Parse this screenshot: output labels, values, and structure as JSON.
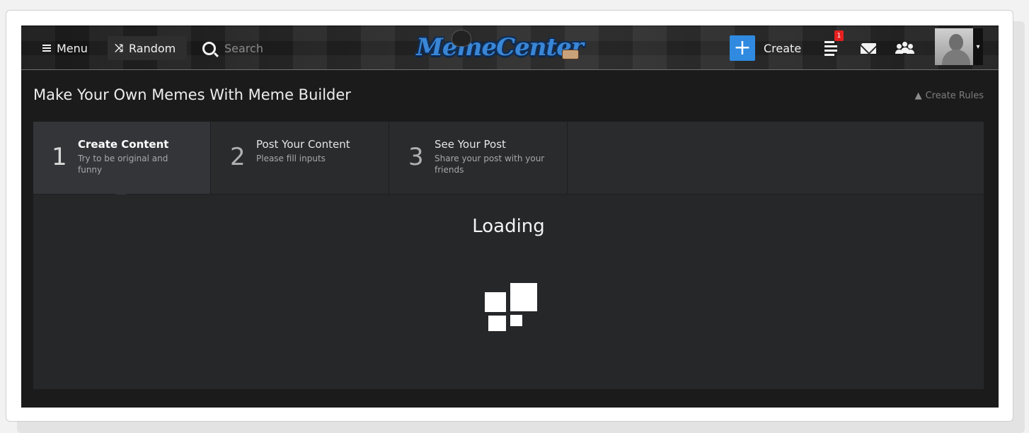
{
  "header": {
    "menu_label": "Menu",
    "random_label": "Random",
    "search_placeholder": "Search",
    "logo_text": "MemeCenter",
    "create_label": "Create",
    "notification_count": "1",
    "icons": {
      "menu": "menu-icon",
      "random": "shuffle-icon",
      "search": "search-icon",
      "create": "plus-icon",
      "notifications": "notifications-icon",
      "messages": "mail-icon",
      "friends": "users-icon",
      "avatar": "avatar-icon"
    }
  },
  "page": {
    "title": "Make Your Own Memes With Meme Builder",
    "rules_label": "Create Rules"
  },
  "steps": [
    {
      "number": "1",
      "title": "Create Content",
      "description": "Try to be original and funny"
    },
    {
      "number": "2",
      "title": "Post Your Content",
      "description": "Please fill inputs"
    },
    {
      "number": "3",
      "title": "See Your Post",
      "description": "Share your post with your friends"
    }
  ],
  "content": {
    "loading_label": "Loading"
  },
  "colors": {
    "accent_blue": "#2f8ae0",
    "badge_red": "#e52020",
    "background_dark": "#1b1b1c"
  }
}
